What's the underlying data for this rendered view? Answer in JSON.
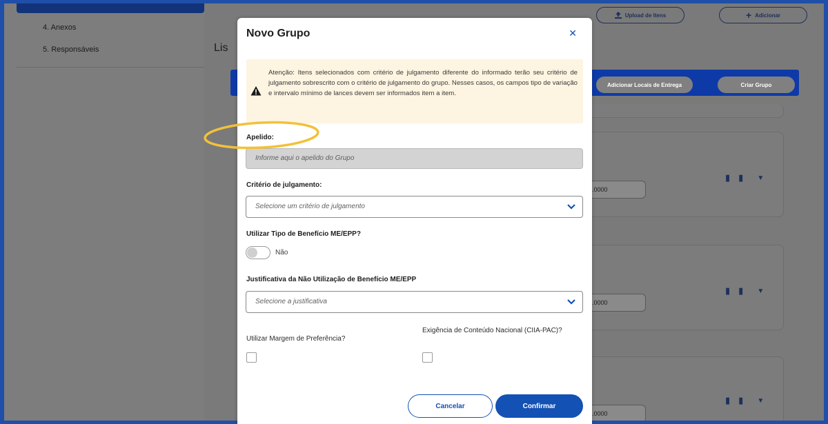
{
  "sidebar": {
    "items": [
      {
        "label": "4. Anexos"
      },
      {
        "label": "5. Responsáveis"
      }
    ]
  },
  "background": {
    "upload_label": "Upload de Itens",
    "add_label": "Adicionar",
    "list_title": "Lis",
    "add_locations_label": "Adicionar Locais de Entrega",
    "create_group_label": "Criar Grupo",
    "item_value": "0.0000"
  },
  "modal": {
    "title": "Novo Grupo",
    "alert_text": "Atenção: Itens selecionados com critério de julgamento diferente do informado terão seu critério de julgamento sobrescrito com o critério de julgamento do grupo. Nesses casos, os campos tipo de variação e intervalo mínimo de lances devem ser informados item a item.",
    "nickname_label": "Apelido:",
    "nickname_placeholder": "Informe aqui o apelido do Grupo",
    "criteria_label": "Critério de julgamento:",
    "criteria_placeholder": "Selecione um critério de julgamento",
    "benefit_label": "Utilizar Tipo de Benefício ME/EPP?",
    "benefit_toggle_text": "Não",
    "justification_label": "Justificativa da Não Utilização de Benefício ME/EPP",
    "justification_placeholder": "Selecione a justificativa",
    "margin_label": "Utilizar Margem de Preferência?",
    "national_label": "Exigência de Conteúdo Nacional (CIIA-PAC)?",
    "cancel_label": "Cancelar",
    "confirm_label": "Confirmar"
  },
  "colors": {
    "primary": "#1351b4",
    "alert_bg": "#fdf4e1",
    "highlight": "#f2c13a"
  }
}
